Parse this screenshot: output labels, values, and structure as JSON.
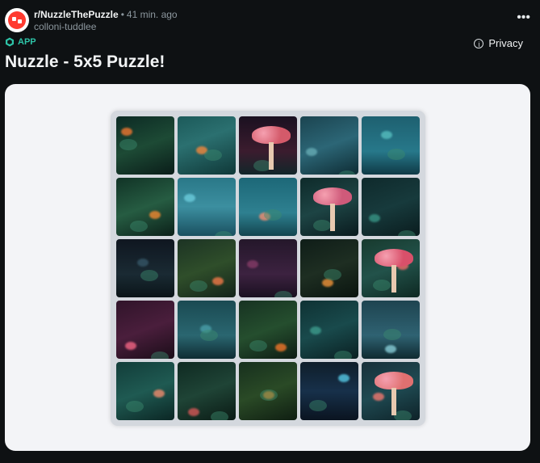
{
  "header": {
    "subreddit": "r/NuzzleThePuzzle",
    "separator": "•",
    "time": "41 min. ago",
    "author": "colloni-tuddlee",
    "more_icon": "more-horizontal-icon",
    "more_glyph": "•••"
  },
  "app_badge": {
    "label": "APP",
    "icon": "cube-icon",
    "color": "#2ec4a8"
  },
  "privacy": {
    "label": "Privacy",
    "icon": "info-icon",
    "glyph": "i"
  },
  "post": {
    "title": "Nuzzle - 5x5 Puzzle!"
  },
  "puzzle": {
    "rows": 5,
    "cols": 5,
    "tile_icon": "puzzle-tile-image",
    "tiles": [
      {
        "bg": "linear-gradient(160deg,#0c2a24,#1d4a35 50%,#0a1d19)",
        "accent": "#ff7a30",
        "mush": ""
      },
      {
        "bg": "linear-gradient(160deg,#1c5a5a,#2b7070 40%,#0f3838)",
        "accent": "#ff8a3a",
        "mush": ""
      },
      {
        "bg": "linear-gradient(180deg,#1a1020,#3b1c2e 60%,#12262a)",
        "accent": "#e56a6a",
        "mush": "#d45a6a"
      },
      {
        "bg": "linear-gradient(160deg,#1b4450,#2c6676 50%,#0e2c34)",
        "accent": "#6ab0b8",
        "mush": ""
      },
      {
        "bg": "linear-gradient(180deg,#1e6070,#27788a 60%,#0f3a46)",
        "accent": "#59c3c3",
        "mush": ""
      },
      {
        "bg": "linear-gradient(160deg,#113326,#265c42 50%,#0b2019)",
        "accent": "#ff8c30",
        "mush": ""
      },
      {
        "bg": "linear-gradient(180deg,#2a7888,#3c8fa0 50%,#1a5060)",
        "accent": "#6fd0e0",
        "mush": ""
      },
      {
        "bg": "linear-gradient(180deg,#1d6878,#2e8090 60%,#13454f)",
        "accent": "#ff9070",
        "mush": ""
      },
      {
        "bg": "linear-gradient(160deg,#0e2a2a,#1d4444 50%,#0a1a1e)",
        "accent": "#e06078",
        "mush": "#cf5a7a"
      },
      {
        "bg": "linear-gradient(160deg,#0f2a2c,#173a3c 50%,#0a1c1e)",
        "accent": "#3a9a8a",
        "mush": ""
      },
      {
        "bg": "linear-gradient(180deg,#0f1620,#1a2a33 60%,#0a1418)",
        "accent": "#37596a",
        "mush": ""
      },
      {
        "bg": "linear-gradient(160deg,#1c3324,#2f4e2a 50%,#13231a)",
        "accent": "#ff7d4a",
        "mush": ""
      },
      {
        "bg": "linear-gradient(180deg,#24172a,#3c2240 60%,#1a1020)",
        "accent": "#8a3d6a",
        "mush": ""
      },
      {
        "bg": "linear-gradient(160deg,#0f1d18,#1e2e22 50%,#0a140f)",
        "accent": "#ff9a3a",
        "mush": ""
      },
      {
        "bg": "linear-gradient(160deg,#183a2e,#22524a 50%,#0e2822)",
        "accent": "#ff6a6a",
        "mush": "#d9506a"
      },
      {
        "bg": "linear-gradient(160deg,#30142a,#4a1e3c 50%,#1a0d18)",
        "accent": "#ff6a8a",
        "mush": ""
      },
      {
        "bg": "linear-gradient(180deg,#1a4a52,#2a6670 60%,#0f2c32)",
        "accent": "#4ba2ac",
        "mush": ""
      },
      {
        "bg": "linear-gradient(160deg,#173322,#254e2e 50%,#0d1c14)",
        "accent": "#ff7a2a",
        "mush": ""
      },
      {
        "bg": "linear-gradient(160deg,#0f3234,#194a4c 50%,#0a2022)",
        "accent": "#3fa090",
        "mush": ""
      },
      {
        "bg": "linear-gradient(180deg,#1e4450,#2f6272 60%,#0f2a30)",
        "accent": "#8fd6e0",
        "mush": ""
      },
      {
        "bg": "linear-gradient(160deg,#123d3a,#1f5a52 50%,#0b2624)",
        "accent": "#ff9070",
        "mush": ""
      },
      {
        "bg": "linear-gradient(160deg,#0f2a22,#1f4436 50%,#0a1a14)",
        "accent": "#e05a5a",
        "mush": ""
      },
      {
        "bg": "linear-gradient(160deg,#17301e,#2a4a26 50%,#0f1e12)",
        "accent": "#ff8a20",
        "mush": ""
      },
      {
        "bg": "linear-gradient(180deg,#0f1e2a,#17304a 50%,#0a1420)",
        "accent": "#5ad4f0",
        "mush": ""
      },
      {
        "bg": "linear-gradient(160deg,#18303a,#1f4a52 50%,#0e2228)",
        "accent": "#ff7a70",
        "mush": "#e07070"
      }
    ]
  }
}
